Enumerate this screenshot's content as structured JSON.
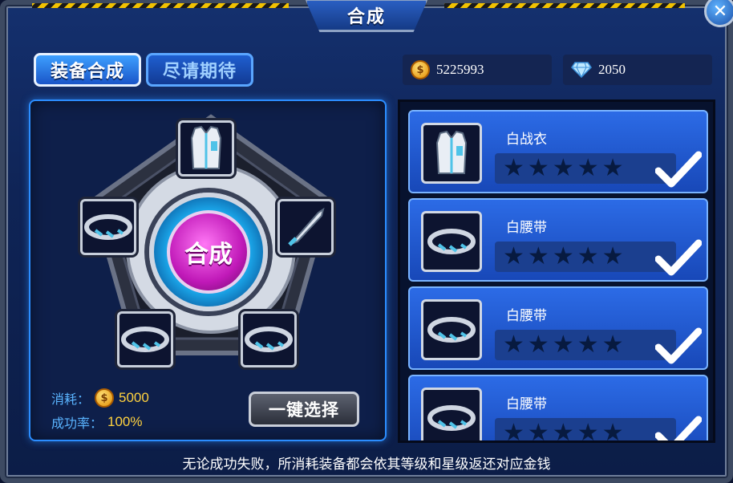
{
  "window": {
    "title": "合成",
    "close_label": "✕"
  },
  "tabs": [
    {
      "label": "装备合成",
      "active": true
    },
    {
      "label": "尽请期待",
      "active": false
    }
  ],
  "currency": {
    "gold": {
      "icon": "coin-icon",
      "value": "5225993"
    },
    "diamond": {
      "icon": "diamond-icon",
      "value": "2050"
    }
  },
  "synthesis": {
    "combine_label": "合成",
    "slots": [
      {
        "name": "slot-top",
        "item": "vest-icon"
      },
      {
        "name": "slot-left",
        "item": "belt-icon"
      },
      {
        "name": "slot-right",
        "item": "knife-icon"
      },
      {
        "name": "slot-bottom-left",
        "item": "belt-icon"
      },
      {
        "name": "slot-bottom-right",
        "item": "belt-icon"
      }
    ],
    "cost_label": "消耗：",
    "cost_value": "5000",
    "rate_label": "成功率：",
    "rate_value": "100%",
    "auto_select_label": "一键选择"
  },
  "materials": [
    {
      "name": "白战衣",
      "icon": "vest-icon",
      "stars": 0,
      "max_stars": 5,
      "selected": true
    },
    {
      "name": "白腰带",
      "icon": "belt-icon",
      "stars": 0,
      "max_stars": 5,
      "selected": true
    },
    {
      "name": "白腰带",
      "icon": "belt-icon",
      "stars": 0,
      "max_stars": 5,
      "selected": true
    },
    {
      "name": "白腰带",
      "icon": "belt-icon",
      "stars": 0,
      "max_stars": 5,
      "selected": true
    }
  ],
  "notice": "无论成功失败，所消耗装备都会依其等级和星级返还对应金钱",
  "colors": {
    "accent": "#2b8dff",
    "combine": "#c019b8",
    "gold_text": "#ffd23f",
    "label_blue": "#5ab4ff"
  }
}
